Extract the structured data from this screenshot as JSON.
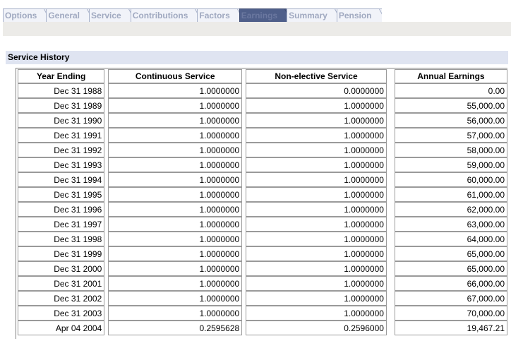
{
  "tabs": [
    {
      "label": "Options",
      "active": false
    },
    {
      "label": "General",
      "active": false
    },
    {
      "label": "Service",
      "active": false
    },
    {
      "label": "Contributions",
      "active": false
    },
    {
      "label": "Factors",
      "active": false
    },
    {
      "label": "Earnings",
      "active": true
    },
    {
      "label": "Summary",
      "active": false
    },
    {
      "label": "Pension",
      "active": false
    }
  ],
  "section": {
    "title": "Service History"
  },
  "table": {
    "headers": [
      "Year Ending",
      "Continuous Service",
      "Non-elective Service",
      "Annual Earnings"
    ],
    "rows": [
      [
        "Dec 31 1988",
        "1.0000000",
        "0.0000000",
        "0.00"
      ],
      [
        "Dec 31 1989",
        "1.0000000",
        "1.0000000",
        "55,000.00"
      ],
      [
        "Dec 31 1990",
        "1.0000000",
        "1.0000000",
        "56,000.00"
      ],
      [
        "Dec 31 1991",
        "1.0000000",
        "1.0000000",
        "57,000.00"
      ],
      [
        "Dec 31 1992",
        "1.0000000",
        "1.0000000",
        "58,000.00"
      ],
      [
        "Dec 31 1993",
        "1.0000000",
        "1.0000000",
        "59,000.00"
      ],
      [
        "Dec 31 1994",
        "1.0000000",
        "1.0000000",
        "60,000.00"
      ],
      [
        "Dec 31 1995",
        "1.0000000",
        "1.0000000",
        "61,000.00"
      ],
      [
        "Dec 31 1996",
        "1.0000000",
        "1.0000000",
        "62,000.00"
      ],
      [
        "Dec 31 1997",
        "1.0000000",
        "1.0000000",
        "63,000.00"
      ],
      [
        "Dec 31 1998",
        "1.0000000",
        "1.0000000",
        "64,000.00"
      ],
      [
        "Dec 31 1999",
        "1.0000000",
        "1.0000000",
        "65,000.00"
      ],
      [
        "Dec 31 2000",
        "1.0000000",
        "1.0000000",
        "65,000.00"
      ],
      [
        "Dec 31 2001",
        "1.0000000",
        "1.0000000",
        "66,000.00"
      ],
      [
        "Dec 31 2002",
        "1.0000000",
        "1.0000000",
        "67,000.00"
      ],
      [
        "Dec 31 2003",
        "1.0000000",
        "1.0000000",
        "70,000.00"
      ],
      [
        "Apr 04 2004",
        "0.2595628",
        "0.2596000",
        "19,467.21"
      ]
    ]
  },
  "colors": {
    "tab_bg": "#f1f3f9",
    "tab_text": "#a0a9c0",
    "tab_active_bg": "#4f5f8a",
    "strip_bg": "#ecebe8",
    "section_bg": "#dfe4f1"
  }
}
